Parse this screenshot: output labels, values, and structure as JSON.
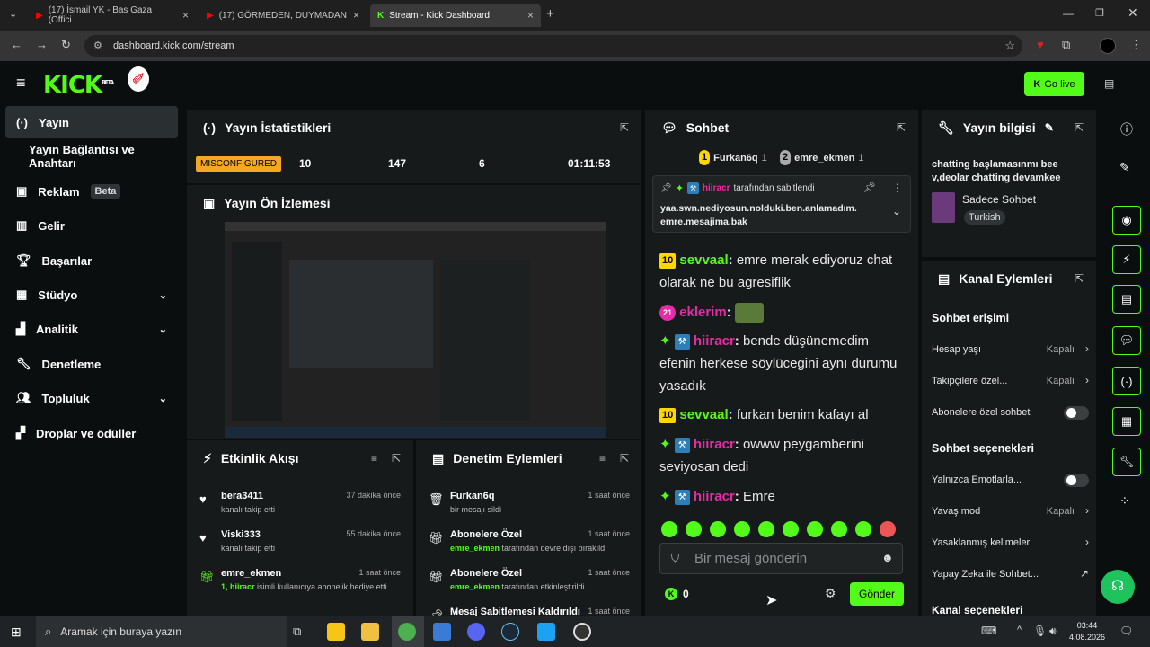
{
  "browser": {
    "tabs": [
      {
        "label": "(17) İsmail YK - Bas Gaza (Offici"
      },
      {
        "label": "(17) GÖRMEDEN, DUYMADAN"
      },
      {
        "label": "Stream - Kick Dashboard"
      }
    ],
    "url": "dashboard.kick.com/stream"
  },
  "header": {
    "logo": "KICK",
    "logo_sup": "BETA",
    "golive_label": "Go live"
  },
  "sidebar": {
    "items": [
      {
        "label": "Yayın"
      },
      {
        "label": "Yayın Bağlantısı ve Anahtarı"
      },
      {
        "label": "Reklam",
        "badge": "Beta"
      },
      {
        "label": "Gelir"
      },
      {
        "label": "Başarılar"
      },
      {
        "label": "Stüdyo"
      },
      {
        "label": "Analitik"
      },
      {
        "label": "Denetleme"
      },
      {
        "label": "Topluluk"
      },
      {
        "label": "Droplar ve ödüller"
      }
    ]
  },
  "stats": {
    "title": "Yayın İstatistikleri",
    "status": "MISCONFIGURED",
    "v1": "10",
    "v2": "147",
    "v3": "6",
    "duration": "01:11:53"
  },
  "preview": {
    "title": "Yayın Ön İzlemesi"
  },
  "activity": {
    "title": "Etkinlik Akışı",
    "rows": [
      {
        "name": "bera3411",
        "sub": "kanalı takip etti",
        "time": "37 dakika önce"
      },
      {
        "name": "Viski333",
        "sub": "kanalı takip etti",
        "time": "55 dakika önce"
      },
      {
        "name": "emre_ekmen",
        "sub_hl": "1, hiiracr",
        "sub": " isimli kullanıcıya abonelik hediye etti.",
        "time": "1 saat önce"
      }
    ]
  },
  "modactions": {
    "title": "Denetim Eylemleri",
    "rows": [
      {
        "name": "Furkan6q",
        "sub": "bir mesajı sildi",
        "time": "1 saat önce"
      },
      {
        "name": "Abonelere Özel",
        "sub_hl": "emre_ekmen",
        "sub": " tarafından devre dışı bırakıldı",
        "time": "1 saat önce"
      },
      {
        "name": "Abonelere Özel",
        "sub_hl": "emre_ekmen",
        "sub": " tarafından etkinleştirildi",
        "time": "1 saat önce"
      },
      {
        "name": "Mesaj Sabitlemesi Kaldırıldı",
        "sub": "",
        "time": "1 saat önce"
      }
    ]
  },
  "chat": {
    "title": "Sohbet",
    "top1": {
      "rank": "1",
      "name": "Furkan6q",
      "count": "1"
    },
    "top2": {
      "rank": "2",
      "name": "emre_ekmen",
      "count": "1"
    },
    "pinned": {
      "by": "hiiracr",
      "by_suffix": "tarafından sabitlendi",
      "text": "yaa.swn.nediyosun.nolduki.ben.anlamadım.emre.mesajima.bak"
    },
    "messages": [
      {
        "lvl": "10",
        "user": "sevvaal",
        "color": "#53fc18",
        "text": "emre merak ediyoruz chat olarak ne bu agresiflik"
      },
      {
        "lvl": "21",
        "user": "eklerim",
        "color": "#e52ba5",
        "text": ""
      },
      {
        "user": "hiiracr",
        "color": "#e52ba5",
        "text": "bende düşünemedim efenin herkese söylücegini aynı durumu yasadık"
      },
      {
        "lvl": "10",
        "user": "sevvaal",
        "color": "#53fc18",
        "text": "furkan benim kafayı al"
      },
      {
        "user": "hiiracr",
        "color": "#e52ba5",
        "text": "owww peygamberini seviyosan dedi"
      },
      {
        "user": "hiiracr",
        "color": "#e52ba5",
        "text": "Emre"
      }
    ],
    "placeholder": "Bir mesaj gönderin",
    "kicks": "0",
    "send_label": "Gönder"
  },
  "info": {
    "title": "Yayın bilgisi",
    "stream_title": "chatting başlamasınmı bee v,deolar chatting devamkee",
    "category": "Sadece Sohbet",
    "language": "Turkish"
  },
  "actions": {
    "title": "Kanal Eylemleri",
    "section1": "Sohbet erişimi",
    "rows1": [
      {
        "label": "Hesap yaşı",
        "value": "Kapalı"
      },
      {
        "label": "Takipçilere özel...",
        "value": "Kapalı"
      },
      {
        "label": "Abonelere özel sohbet"
      }
    ],
    "section2": "Sohbet seçenekleri",
    "rows2": [
      {
        "label": "Yalnızca Emotlarla..."
      },
      {
        "label": "Yavaş mod",
        "value": "Kapalı"
      },
      {
        "label": "Yasaklanmış kelimeler"
      },
      {
        "label": "Yapay Zeka ile Sohbet..."
      }
    ],
    "section3": "Kanal seçenekleri"
  },
  "taskbar": {
    "search_placeholder": "Aramak için buraya yazın",
    "time": "03:44",
    "date": "4.08.2026"
  }
}
